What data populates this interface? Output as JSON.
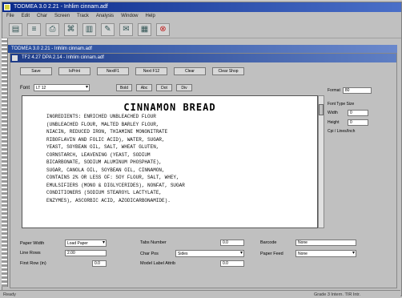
{
  "app": {
    "title": "TODMEA 3.0 2.21 - Inhlim cinnam.adf"
  },
  "menu": [
    "File",
    "Edit",
    "Char",
    "Screen",
    "Track",
    "Analysis",
    "Window",
    "Help"
  ],
  "toolbar": {
    "icons": [
      "open-icon",
      "save-icon",
      "print-icon",
      "tag-icon",
      "bar-icon",
      "pencil-icon",
      "note-icon",
      "grid-icon",
      "stop-icon"
    ]
  },
  "inner_window": {
    "title": "TODMEA 3.0 2.21 - Inhlim cinnam.adf"
  },
  "doc_window": {
    "title": "TF2 4.27 DPA 2.14 - Inhlim cinnam.adf"
  },
  "doc_buttons": [
    "Save",
    "IsPrint",
    "NextF1",
    "Next F12",
    "Clear",
    "Clear Shop"
  ],
  "font_row": {
    "label": "Font",
    "font_value": "LT 12",
    "buttons": [
      "Bold",
      "Abc",
      "Dot",
      "Div"
    ]
  },
  "editor": {
    "heading": "CINNAMON BREAD",
    "lines": [
      "INGREDIENTS: ENRICHED UNBLEACHED FLOUR",
      "(UNBLEACHED FLOUR, MALTED BARLEY FLOUR,",
      "NIACIN, REDUCED IRON, THIAMINE MONONITRATE",
      "RIBOFLAVIN AND FOLIC ACID), WATER, SUGAR,",
      "YEAST, SOYBEAN OIL, SALT, WHEAT GLUTEN,",
      "CORNSTARCH, LEAVENING (YEAST, SODIUM",
      "BICARBONATE, SODIUM ALUMINUM PHOSPHATE),",
      "SUGAR, CANOLA OIL, SOYBEAN OIL, CINNAMON,",
      "CONTAINS 2% OR LESS OF: SOY FLOUR, SALT, WHEY,",
      "EMULSIFIERS (MONO & DIGLYCERIDES), NONFAT, SUGAR",
      "CONDITIONERS (SODIUM STEAROYL LACTYLATE,",
      "ENZYMES), ASCORBIC ACID, AZODICARBONAMIDE)."
    ]
  },
  "side_panel": {
    "format_label": "Format",
    "format_value": "80",
    "font_type_label": "Font Type Size",
    "width_label": "Width",
    "width_value": "0",
    "height_label": "Height",
    "height_value": "0",
    "note": "Cpi / Lines/Inch"
  },
  "bottom_fields": {
    "paper_width_label": "Paper Width",
    "paper_width_value": "Load Paper",
    "line_rows_label": "Line Rows",
    "line_rows_value": "2.00",
    "first_row_label": "First Row (in)",
    "first_row_value": "0.0",
    "tabs_number_label": "Tabs Number",
    "tabs_number_value": "0.0",
    "char_pos_label": "Char Pos",
    "char_pos_value": "Sides",
    "mode_label": "Model Label Attrib",
    "mode_value": "0.0",
    "barcode_label": "Barcode",
    "barcode_value": "None",
    "paper_feed_label": "Paper Feed",
    "paper_feed_value": "None"
  },
  "status": {
    "left": "Ready",
    "right": "Grade 3 Intern. TIR Intr."
  }
}
